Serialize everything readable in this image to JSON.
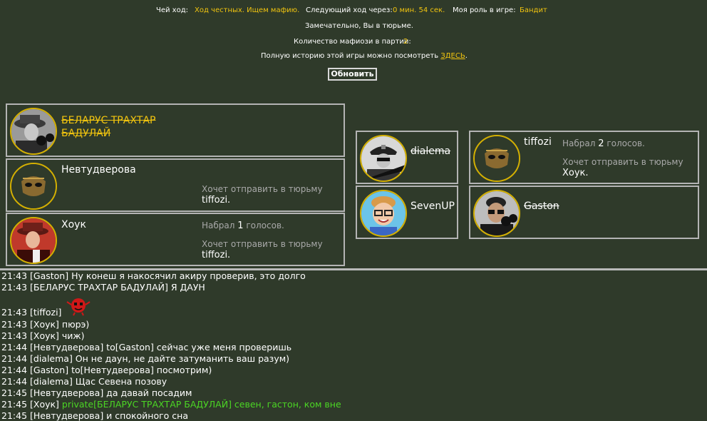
{
  "header": {
    "turn_label": "Чей ход:",
    "turn_value": "Ход честных. Ищем мафию.",
    "next_label": "Следующий ход через:",
    "next_value": "0 мин. 54 сек.",
    "role_label": "Моя роль в игре:",
    "role_value": "Бандит",
    "jail_text": "Замечательно, Вы в тюрьме.",
    "mafia_label": "Количество мафиози в партии:",
    "mafia_value": "2",
    "history_text": "Полную историю этой игры можно посмотреть",
    "history_link": "ЗДЕСЬ",
    "history_dot": ".",
    "refresh_button": "Обновить"
  },
  "players_left": [
    {
      "name_line1": "БЕЛАРУС ТРАХТАР",
      "name_line2": "БАДУЛАЙ",
      "dead": true
    },
    {
      "name": "Невтудверова",
      "wants_label": "Хочет отправить в тюрьму",
      "wants_target": "tiffozi."
    },
    {
      "name": "Хоук",
      "votes_prefix": "Набрал",
      "votes_count": "1",
      "votes_suffix": "голосов.",
      "wants_label": "Хочет отправить в тюрьму",
      "wants_target": "tiffozi."
    }
  ],
  "players_mid": [
    {
      "name": "dialema",
      "dead": true
    },
    {
      "name": "SevenUP"
    }
  ],
  "players_right": [
    {
      "name": "tiffozi",
      "votes_prefix": "Набрал",
      "votes_count": "2",
      "votes_suffix": "голосов.",
      "wants_label": "Хочет отправить в тюрьму",
      "wants_target": "Хоук."
    },
    {
      "name": "Gaston",
      "dead": true
    }
  ],
  "chat": [
    {
      "time": "21:43",
      "text": "[Gaston] Ну конеш я накосячил акиру проверив, это долго"
    },
    {
      "time": "21:43",
      "text": "[БЕЛАРУС ТРАХТАР БАДУЛАЙ] Я ДАУН"
    },
    {
      "time": "21:43",
      "text": "[tiffozi]"
    },
    {
      "time": "21:43",
      "text": "[Хоук] пюрэ)"
    },
    {
      "time": "21:43",
      "text": "[Хоук] чиж)"
    },
    {
      "time": "21:44",
      "text": "[Невтудверова] to[Gaston] сейчас уже меня проверишь"
    },
    {
      "time": "21:44",
      "text": "[dialema] Он не даун, не дайте затуманить ваш разум)"
    },
    {
      "time": "21:44",
      "text": "[Gaston] to[Невтудверова] посмотрим)"
    },
    {
      "time": "21:44",
      "text": "[dialema] Щас Севена позову"
    },
    {
      "time": "21:45",
      "text": "[Невтудверова] да давай посадим"
    },
    {
      "time": "21:45",
      "text": "[Хоук]",
      "private": "private[БЕЛАРУС ТРАХТАР БАДУЛАЙ] севен, гастон, ком вне"
    },
    {
      "time": "21:45",
      "text": "[Невтудверова] и спокойного сна"
    }
  ],
  "colors": {
    "background": "#2f3a2a",
    "accent_yellow": "#f1c40f",
    "border": "#b4b4b4",
    "private_green": "#4bd624"
  }
}
